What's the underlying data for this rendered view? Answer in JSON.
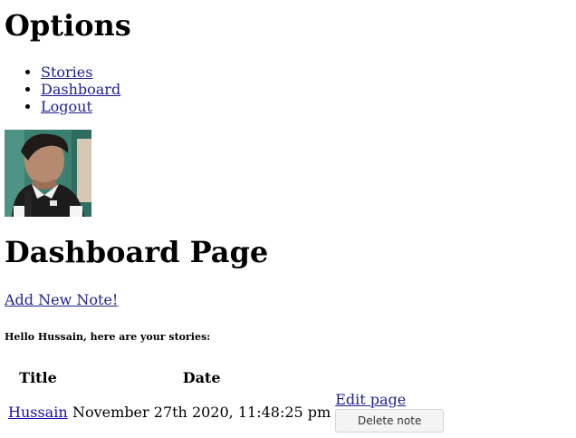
{
  "header": {
    "title": "Options"
  },
  "nav": {
    "items": [
      {
        "label": "Stories"
      },
      {
        "label": "Dashboard"
      },
      {
        "label": "Logout"
      }
    ]
  },
  "profile": {
    "avatar_icon": "user-avatar-photo"
  },
  "dashboard": {
    "title": "Dashboard Page",
    "add_note_label": "Add New Note!",
    "greeting": "Hello Hussain, here are your stories:"
  },
  "stories_table": {
    "columns": [
      "Title",
      "Date"
    ],
    "rows": [
      {
        "title": "Hussain",
        "date": "November 27th 2020, 11:48:25 pm",
        "edit_label": "Edit page",
        "delete_label": "Delete note"
      }
    ]
  },
  "colors": {
    "link": "#1f1f8f",
    "button_bg": "#f4f4f4",
    "button_border": "#d4d4d4"
  }
}
